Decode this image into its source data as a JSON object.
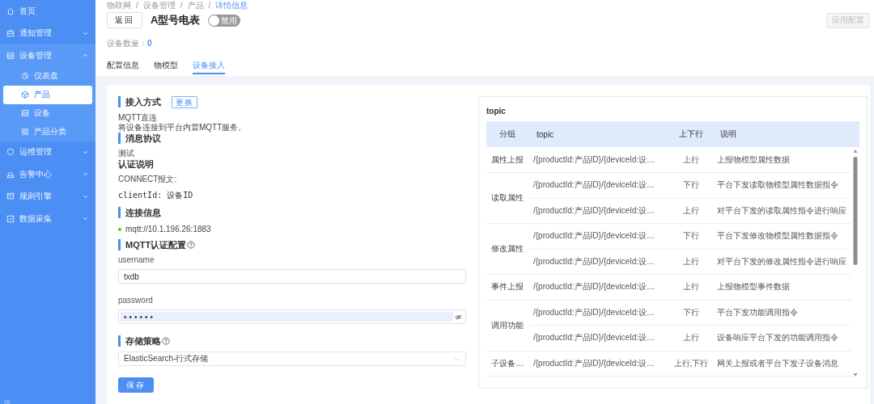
{
  "sidebar": {
    "items": [
      {
        "label": "首页",
        "selected": false
      },
      {
        "label": "通知管理",
        "selected": false,
        "expanded": false
      },
      {
        "label": "设备管理",
        "selected": false,
        "expanded": true,
        "children": [
          {
            "label": "仪表盘",
            "selected": false
          },
          {
            "label": "产品",
            "selected": true
          },
          {
            "label": "设备",
            "selected": false
          },
          {
            "label": "产品分类",
            "selected": false
          }
        ]
      },
      {
        "label": "运维管理",
        "selected": false,
        "expanded": false
      },
      {
        "label": "告警中心",
        "selected": false,
        "expanded": false
      },
      {
        "label": "规则引擎",
        "selected": false,
        "expanded": false
      },
      {
        "label": "数据采集",
        "selected": false,
        "expanded": false
      }
    ]
  },
  "breadcrumb": {
    "separator": "/",
    "items": [
      "物联网",
      "设备管理",
      "产品",
      "详情信息"
    ]
  },
  "header": {
    "back_button": "返回",
    "title": "A型号电表",
    "status_switch": {
      "label": "禁用",
      "on": false
    },
    "apply_button": {
      "label": "应用配置",
      "disabled": true
    },
    "device_count": {
      "label": "设备数量：",
      "value": "0"
    }
  },
  "tabs": [
    {
      "label": "配置信息",
      "selected": false
    },
    {
      "label": "物模型",
      "selected": false
    },
    {
      "label": "设备接入",
      "selected": true
    }
  ],
  "access": {
    "method": {
      "heading": "接入方式",
      "action": "更换",
      "name": "MQTT直连",
      "description": "将设备连接到平台内置MQTT服务。"
    },
    "protocol": {
      "heading": "消息协议",
      "name": "测试"
    },
    "auth": {
      "heading": "认证说明",
      "connect": "CONNECT报文:",
      "client_id": "clientId: 设备ID"
    },
    "connection": {
      "heading": "连接信息",
      "url": "mqtt://10.1.196.26:1883",
      "online": true
    },
    "mqtt_auth": {
      "heading": "MQTT认证配置",
      "help": true,
      "fields": [
        {
          "label": "username",
          "value": "txdb",
          "kind": "text"
        },
        {
          "label": "password",
          "value": "••••••",
          "kind": "password"
        }
      ]
    },
    "storage": {
      "heading": "存储策略",
      "help": true,
      "value": "ElasticSearch-行式存储"
    },
    "save_button": "保存"
  },
  "topic_panel": {
    "title": "topic",
    "columns": [
      "分组",
      "topic",
      "上下行",
      "说明"
    ],
    "groups": [
      {
        "name": "属性上报",
        "rows": [
          {
            "topic": "/{productId:产品ID}/{deviceId:设…",
            "direction": "上行",
            "description": "上报物模型属性数据"
          }
        ]
      },
      {
        "name": "读取属性",
        "rows": [
          {
            "topic": "/{productId:产品ID}/{deviceId:设…",
            "direction": "下行",
            "description": "平台下发读取物模型属性数据指令"
          },
          {
            "topic": "/{productId:产品ID}/{deviceId:设…",
            "direction": "上行",
            "description": "对平台下发的读取属性指令进行响应"
          }
        ]
      },
      {
        "name": "修改属性",
        "rows": [
          {
            "topic": "/{productId:产品ID}/{deviceId:设…",
            "direction": "下行",
            "description": "平台下发修改物模型属性数据指令"
          },
          {
            "topic": "/{productId:产品ID}/{deviceId:设…",
            "direction": "上行",
            "description": "对平台下发的修改属性指令进行响应"
          }
        ]
      },
      {
        "name": "事件上报",
        "rows": [
          {
            "topic": "/{productId:产品ID}/{deviceId:设…",
            "direction": "上行",
            "description": "上报物模型事件数据"
          }
        ]
      },
      {
        "name": "调用功能",
        "rows": [
          {
            "topic": "/{productId:产品ID}/{deviceId:设…",
            "direction": "下行",
            "description": "平台下发功能调用指令"
          },
          {
            "topic": "/{productId:产品ID}/{deviceId:设…",
            "direction": "上行",
            "description": "设备响应平台下发的功能调用指令"
          }
        ]
      },
      {
        "name": "子设备…",
        "rows": [
          {
            "topic": "/{productId:产品ID}/{deviceId:设…",
            "direction": "上行,下行",
            "description": "网关上报或者平台下发子设备消息"
          }
        ]
      }
    ]
  }
}
